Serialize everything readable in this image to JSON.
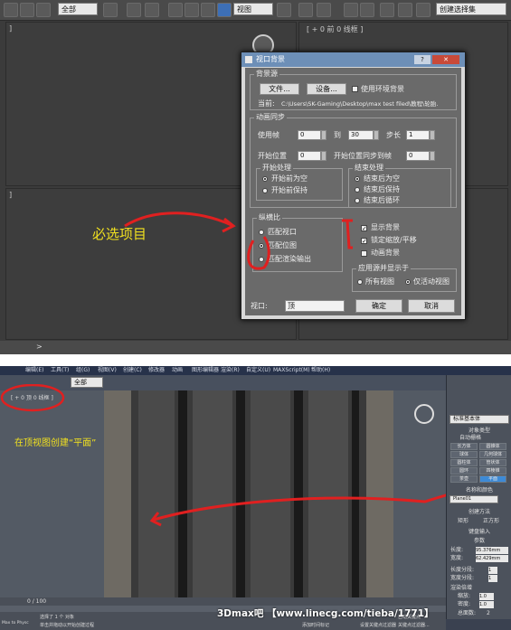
{
  "top_panel": {
    "toolbar": {
      "selection_filter": "全部",
      "view_dropdown": "视图",
      "named_selection": "创建选择集"
    },
    "viewport_top_left_label": "]",
    "viewport_top_right_label": "[ + 0 前 0 线框 ]",
    "viewport_bottom_left_label": "]",
    "timeline_arrow": ">",
    "annotation_must_select": "必选项目",
    "dialog": {
      "title": "视口背景",
      "close_symbol": "✕",
      "help_symbol": "?",
      "source_group": "背景源",
      "files_button": "文件...",
      "devices_button": "设备...",
      "use_env_checkbox": "使用环境背景",
      "current_label": "当前:",
      "current_path": "C:\\Users\\SK-Gaming\\Desktop\\max test filed\\教程\\轮胎.",
      "anim_group": "动画同步",
      "use_frame_label": "使用帧",
      "use_frame_value": "0",
      "to_label": "到",
      "to_value": "30",
      "step_label": "步长",
      "step_value": "1",
      "start_pos_label": "开始位置",
      "start_pos_value": "0",
      "sync_start_label": "开始位置同步到帧",
      "sync_start_value": "0",
      "start_proc_group": "开始处理",
      "start_proc_options": [
        "开始前为空",
        "开始前保持"
      ],
      "end_proc_group": "结束处理",
      "end_proc_options": [
        "结束后为空",
        "结束后保持",
        "结束后循环"
      ],
      "aspect_group": "纵横比",
      "aspect_options": [
        "匹配视口",
        "匹配位图",
        "匹配渲染输出"
      ],
      "display_bg": "显示背景",
      "lock_zoom_pan": "锁定缩放/平移",
      "anim_bg": "动画背景",
      "apply_source_group": "应用源并显示于",
      "apply_options": [
        "所有视图",
        "仅活动视图"
      ],
      "viewport_label": "视口:",
      "viewport_value": "顶",
      "ok_button": "确定",
      "cancel_button": "取消"
    }
  },
  "bottom_panel": {
    "menus": [
      "编辑(E)",
      "工具(T)",
      "组(G)",
      "视图(V)",
      "创建(C)",
      "修改器",
      "动画",
      "图形编辑器",
      "渲染(R)",
      "自定义(U)",
      "MAXScript(M)",
      "帮助(H)"
    ],
    "toolbar_selection_filter": "全部",
    "viewport_label": "[ + 0 顶 0 线框 ]",
    "annotation_create_plane": "在顶视图创建“平面”",
    "command_panel": {
      "dropdown": "标准基本体",
      "object_type": "对象类型",
      "auto_grid": "自动栅格",
      "buttons": [
        "长方体",
        "圆锥体",
        "球体",
        "几何球体",
        "圆柱体",
        "管状体",
        "圆环",
        "四棱锥",
        "茶壶",
        "平面"
      ],
      "name_color": "名称和颜色",
      "name_value": "Plane01",
      "creation_method": "创建方法",
      "creation_options": [
        "矩形",
        "正方形"
      ],
      "keyboard_entry": "键盘输入",
      "params": "参数",
      "length_label": "长度:",
      "length_value": "95.376mm",
      "width_label": "宽度:",
      "width_value": "62.429mm",
      "length_segs_label": "长度分段:",
      "length_segs_value": "1",
      "width_segs_label": "宽度分段:",
      "width_segs_value": "1",
      "render_mult": "渲染倍增",
      "scale_label": "缩放:",
      "scale_value": "1.0",
      "density_label": "密度:",
      "density_value": "1.0",
      "total_faces_label": "总面数:",
      "total_faces_value": "2"
    },
    "status_frame": "0 / 100",
    "status_selected": "选择了 1 个 对象",
    "status_hint": "单击并拖动以开始创建过程",
    "status_left": "Max to Physc",
    "status_add_tag": "添加时间标记",
    "status_grid": "设置关键点过滤器",
    "status_auto_key": "自动关键点",
    "status_set_key": "关键点过滤器...",
    "watermark": "3Dmax吧 【www.linecg.com/tieba/1771】"
  },
  "colors": {
    "annotation_red": "#e02020",
    "annotation_yellow": "#f0e020",
    "title_blue": "#6d8fb7"
  }
}
